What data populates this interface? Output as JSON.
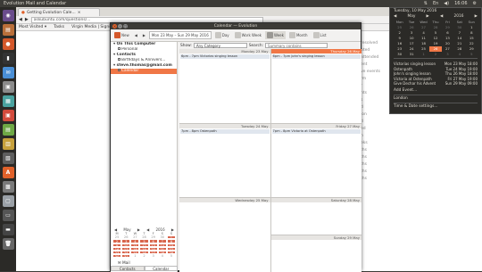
{
  "topbar": {
    "window_title": "Evolution Mail and Calendar",
    "time": "16:06"
  },
  "launcher": {
    "apps": [
      {
        "name": "dash",
        "color": "#6a4c8c",
        "glyph": "◉"
      },
      {
        "name": "files",
        "color": "#b96f3a",
        "glyph": "▤"
      },
      {
        "name": "firefox",
        "color": "#d4582b",
        "glyph": "●"
      },
      {
        "name": "terminal",
        "color": "#333",
        "glyph": "▮"
      },
      {
        "name": "evolution",
        "color": "#4a8fd6",
        "glyph": "✉"
      },
      {
        "name": "app6",
        "color": "#8b8b8b",
        "glyph": "▣"
      },
      {
        "name": "app7",
        "color": "#4aa3a0",
        "glyph": "▦"
      },
      {
        "name": "app8",
        "color": "#d24b3d",
        "glyph": "▣"
      },
      {
        "name": "app9",
        "color": "#6ea845",
        "glyph": "▤"
      },
      {
        "name": "app10",
        "color": "#c7a13c",
        "glyph": "▥"
      },
      {
        "name": "app11",
        "color": "#5e5e5e",
        "glyph": "▧"
      },
      {
        "name": "app12",
        "color": "#e0612a",
        "glyph": "A"
      },
      {
        "name": "app13",
        "color": "#7a7a7a",
        "glyph": "▩"
      },
      {
        "name": "app14",
        "color": "#9aa0a6",
        "glyph": "▢"
      },
      {
        "name": "app15",
        "color": "#555",
        "glyph": "▭"
      },
      {
        "name": "app16",
        "color": "#444",
        "glyph": "▬"
      },
      {
        "name": "trash",
        "color": "#666",
        "glyph": "🗑"
      }
    ]
  },
  "browser": {
    "tab_label": "Getting Evolution Cale...",
    "url": "askubuntu.com/questions/...",
    "bookmarks": [
      "Most Visited ▾",
      "Tasks",
      "Virgin Media | Signin ..."
    ]
  },
  "page": {
    "background_text": "",
    "right_list": [
      "resolved",
      "pted",
      "attended",
      "ent",
      "ve events",
      "rm",
      "r",
      "hts",
      "s",
      "d",
      "ion",
      "d",
      "ed",
      "n",
      "eks",
      "ths",
      "ths",
      "ths",
      "ths",
      "ths"
    ]
  },
  "evolution": {
    "title": "Calendar — Evolution",
    "toolbar": {
      "new": "New",
      "date_range": "Mon 23 May – Sun 29 May 2016",
      "day": "Day",
      "work_week": "Work Week",
      "week": "Week",
      "month": "Month",
      "list": "List"
    },
    "filter": {
      "show_label": "Show:",
      "show_value": "Any Category",
      "search_label": "Search:",
      "search_value": "Summary contains"
    },
    "sidebar": {
      "groups": [
        {
          "label": "On This Computer",
          "items": [
            {
              "label": "Personal",
              "selected": false
            }
          ]
        },
        {
          "label": "Contacts",
          "items": [
            {
              "label": "Birthdays & Annivers...",
              "selected": false
            }
          ]
        },
        {
          "label": "steve.thomas@gmail.com",
          "items": [
            {
              "label": "Calendar",
              "selected": true
            }
          ]
        }
      ],
      "mini_cal": {
        "month": "May",
        "year": "2016",
        "weekdays": [
          "M",
          "T",
          "W",
          "T",
          "F",
          "S",
          "S"
        ],
        "days": [
          {
            "d": "25",
            "o": true
          },
          {
            "d": "26",
            "o": true
          },
          {
            "d": "27",
            "o": true
          },
          {
            "d": "28",
            "o": true
          },
          {
            "d": "29",
            "o": true
          },
          {
            "d": "30",
            "o": true
          },
          {
            "d": "1",
            "o": false
          },
          {
            "d": "2",
            "o": false
          },
          {
            "d": "3",
            "o": false
          },
          {
            "d": "4",
            "o": false
          },
          {
            "d": "5",
            "o": false
          },
          {
            "d": "6",
            "o": false
          },
          {
            "d": "7",
            "o": false
          },
          {
            "d": "8",
            "o": false
          },
          {
            "d": "9",
            "o": false
          },
          {
            "d": "10",
            "o": false
          },
          {
            "d": "11",
            "o": false
          },
          {
            "d": "12",
            "o": false
          },
          {
            "d": "13",
            "o": false
          },
          {
            "d": "14",
            "o": false
          },
          {
            "d": "15",
            "o": false
          },
          {
            "d": "16",
            "o": false
          },
          {
            "d": "17",
            "o": false
          },
          {
            "d": "18",
            "o": false
          },
          {
            "d": "19",
            "o": false
          },
          {
            "d": "20",
            "o": false
          },
          {
            "d": "21",
            "o": false
          },
          {
            "d": "22",
            "o": false
          },
          {
            "d": "23",
            "o": false
          },
          {
            "d": "24",
            "o": false
          },
          {
            "d": "25",
            "o": false
          },
          {
            "d": "26",
            "o": false
          },
          {
            "d": "27",
            "o": false
          },
          {
            "d": "28",
            "o": false
          },
          {
            "d": "29",
            "o": false
          },
          {
            "d": "30",
            "o": false
          },
          {
            "d": "31",
            "o": false
          },
          {
            "d": "1",
            "o": true
          },
          {
            "d": "2",
            "o": true
          },
          {
            "d": "3",
            "o": true
          },
          {
            "d": "4",
            "o": true
          },
          {
            "d": "5",
            "o": true
          }
        ]
      },
      "mail": "Mail",
      "tabs": [
        "Contacts",
        "Calendar"
      ]
    },
    "week": {
      "days": [
        {
          "head": "Monday 23 May",
          "today": false,
          "events": [
            "6pm - 7pm  Victorias singing lesson"
          ]
        },
        {
          "head": "Thursday 26 May",
          "today": true,
          "events": [
            "6pm - 7pm  John's singing lesson"
          ]
        },
        {
          "head": "Tuesday 24 May",
          "today": false,
          "events": [
            "7pm - 8pm  Ostenpath"
          ]
        },
        {
          "head": "Friday 27 May",
          "today": false,
          "events": [
            "7pm - 8pm  Victoria at Ostenpath"
          ]
        },
        {
          "head": "Wednesday 25 May",
          "today": false,
          "events": []
        },
        {
          "head": "Saturday 28 May",
          "today": false,
          "events": []
        },
        {
          "head": "Sunday 29 May",
          "today": false,
          "events": []
        }
      ]
    }
  },
  "indicator": {
    "date_line": "Tuesday, 10 May 2016",
    "month": "May",
    "year": "2016",
    "weekdays": [
      "Mon",
      "Tue",
      "Wed",
      "Thu",
      "Fri",
      "Sat",
      "Sun"
    ],
    "days": [
      {
        "d": "25",
        "o": true
      },
      {
        "d": "26",
        "o": true
      },
      {
        "d": "27",
        "o": true
      },
      {
        "d": "28",
        "o": true
      },
      {
        "d": "29",
        "o": true
      },
      {
        "d": "30",
        "o": true
      },
      {
        "d": "1",
        "o": false
      },
      {
        "d": "2",
        "o": false
      },
      {
        "d": "3",
        "o": false
      },
      {
        "d": "4",
        "o": false
      },
      {
        "d": "5",
        "o": false
      },
      {
        "d": "6",
        "o": false
      },
      {
        "d": "7",
        "o": false
      },
      {
        "d": "8",
        "o": false
      },
      {
        "d": "9",
        "o": false
      },
      {
        "d": "10",
        "o": false
      },
      {
        "d": "11",
        "o": false
      },
      {
        "d": "12",
        "o": false
      },
      {
        "d": "13",
        "o": false
      },
      {
        "d": "14",
        "o": false
      },
      {
        "d": "15",
        "o": false
      },
      {
        "d": "16",
        "o": false
      },
      {
        "d": "17",
        "o": false
      },
      {
        "d": "18",
        "o": false
      },
      {
        "d": "19",
        "o": false
      },
      {
        "d": "20",
        "o": false
      },
      {
        "d": "21",
        "o": false
      },
      {
        "d": "22",
        "o": false
      },
      {
        "d": "23",
        "o": false
      },
      {
        "d": "24",
        "o": false
      },
      {
        "d": "25",
        "o": false
      },
      {
        "d": "26",
        "o": false,
        "today": true
      },
      {
        "d": "27",
        "o": false
      },
      {
        "d": "28",
        "o": false
      },
      {
        "d": "29",
        "o": false
      },
      {
        "d": "30",
        "o": false
      },
      {
        "d": "31",
        "o": false
      },
      {
        "d": "1",
        "o": true
      },
      {
        "d": "2",
        "o": true
      },
      {
        "d": "3",
        "o": true
      },
      {
        "d": "4",
        "o": true
      },
      {
        "d": "5",
        "o": true
      }
    ],
    "events": [
      {
        "name": "Victorias singing lesson",
        "when": "Mon 23 May 18:00"
      },
      {
        "name": "Ostenpath",
        "when": "Tue 24 May 19:00"
      },
      {
        "name": "John's singing lesson",
        "when": "Thu 26 May 18:00"
      },
      {
        "name": "Victoria at Ostenpath",
        "when": "Fri 27 May 19:00"
      },
      {
        "name": "Give Dechar his Advent",
        "when": "Sun 29 May 09:00"
      }
    ],
    "add_event": "Add Event...",
    "location": "London",
    "settings": "Time & Date settings..."
  }
}
